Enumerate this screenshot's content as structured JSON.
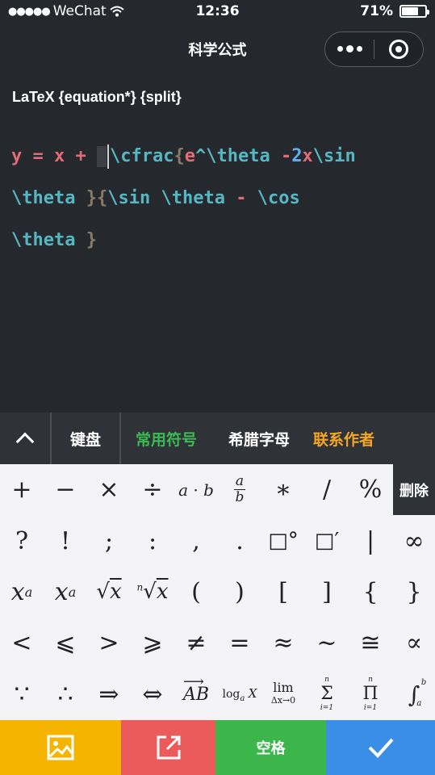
{
  "status": {
    "carrier": "WeChat",
    "time": "12:36",
    "battery": "71%",
    "battery_level": 0.71
  },
  "nav": {
    "title": "科学公式"
  },
  "editor": {
    "label": "LaTeX {equation*} {split}",
    "line1": {
      "a": "y",
      "b": " = ",
      "c": "x",
      "d": " + ",
      "e": "\\cfrac",
      "f": "{",
      "g": "e",
      "h": "^",
      "i": "\\theta",
      "j": " -",
      "k": "2",
      "l": "x",
      "m": "\\sin"
    },
    "line2": {
      "a": "\\theta",
      "b": " }",
      "c": "{",
      "d": "\\sin",
      "e": " ",
      "f": "\\theta",
      "g": " - ",
      "h": "\\cos"
    },
    "line3": {
      "a": "\\theta",
      "b": " }"
    }
  },
  "tabs": {
    "keyboard": "键盘",
    "common": "常用符号",
    "greek": "希腊字母",
    "contact": "联系作者"
  },
  "keys": {
    "row1": [
      "+",
      "−",
      "×",
      "÷",
      "a · b",
      "a/b",
      "∗",
      "/",
      "%"
    ],
    "delete": "删除",
    "row2": [
      "?",
      "!",
      ";",
      ":",
      ",",
      ".",
      "□°",
      "□′",
      "|",
      "∞"
    ],
    "row3": [
      "x^a",
      "x_a",
      "√x",
      "ⁿ√x",
      "(",
      ")",
      "[",
      "]",
      "{",
      "}"
    ],
    "row4": [
      "<",
      "⩽",
      ">",
      "⩾",
      "≠",
      "=",
      "≈",
      "~",
      "≅",
      "∝"
    ],
    "row5": [
      "∵",
      "∴",
      "⇒",
      "⇔",
      "AB→",
      "log_a X",
      "lim Δx→0",
      "Σ i=1 n",
      "Π i=1 n",
      "∫ a b"
    ]
  },
  "bottom": {
    "space": "空格"
  },
  "icons": [
    "image-icon",
    "share-icon",
    "check-icon",
    "menu-dots-icon",
    "close-circle-icon",
    "wifi-icon",
    "chevron-up-icon"
  ]
}
